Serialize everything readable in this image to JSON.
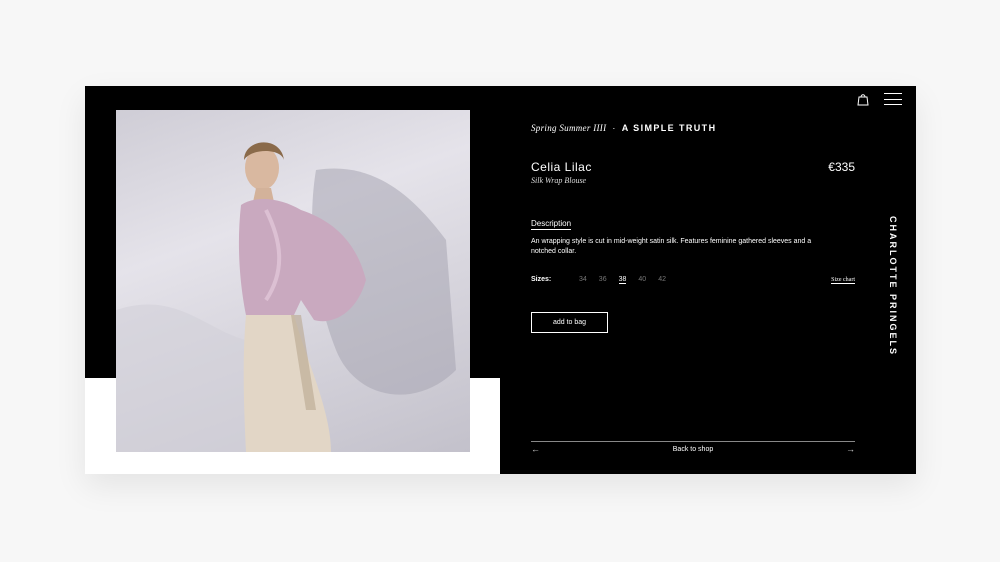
{
  "header": {
    "bag_icon": "shopping-bag-icon",
    "menu_icon": "hamburger-menu-icon"
  },
  "collection": {
    "season": "Spring Summer IIII",
    "separator": "·",
    "tagline": "A SIMPLE TRUTH"
  },
  "product": {
    "name": "Celia Lilac",
    "subtitle": "Silk Wrap Blouse",
    "price": "€335",
    "description_label": "Description",
    "description": "An wrapping style is cut in mid-weight satin silk. Features feminine gathered sleeves and a notched collar.",
    "sizes_label": "Sizes:",
    "sizes": [
      "34",
      "36",
      "38",
      "40",
      "42"
    ],
    "selected_size": "38",
    "size_chart_label": "Size chart",
    "add_to_bag": "add to bag"
  },
  "footer": {
    "back_label": "Back to shop",
    "prev_icon": "arrow-left-icon",
    "next_icon": "arrow-right-icon"
  },
  "brand": "CHARLOTTE PRINGELS",
  "colors": {
    "panel": "#000000",
    "background": "#f7f7f7",
    "text": "#ffffff"
  }
}
